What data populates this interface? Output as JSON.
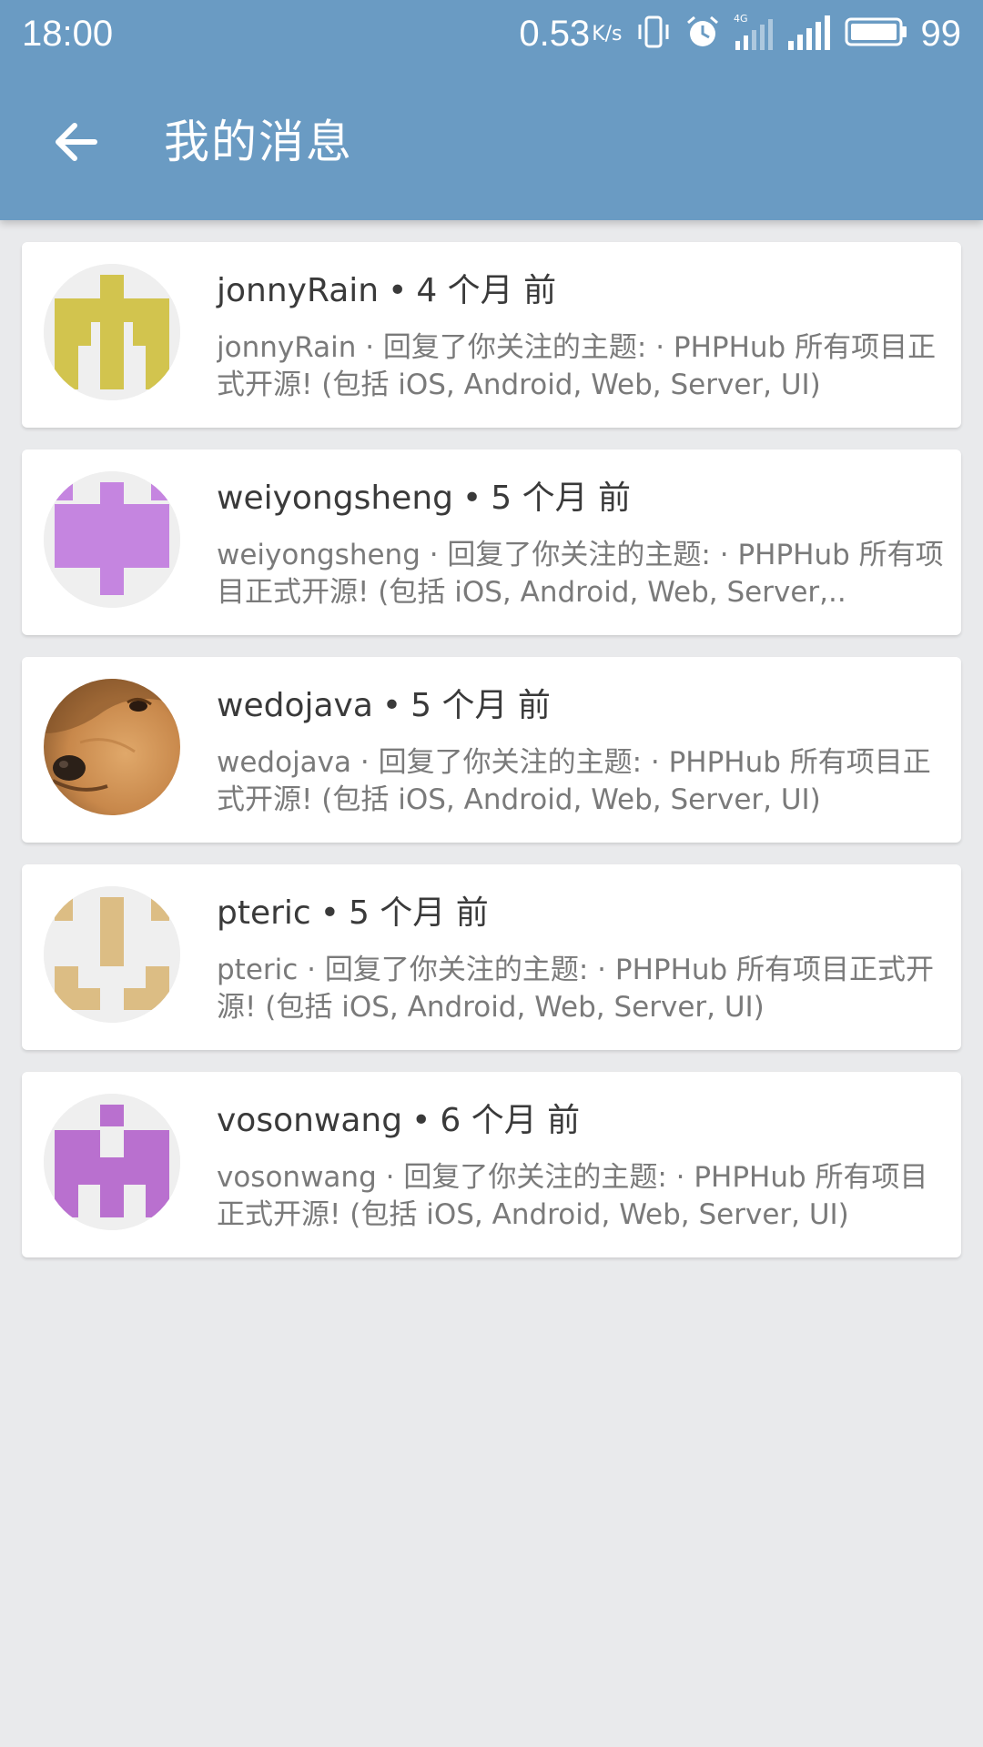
{
  "status_bar": {
    "time": "18:00",
    "speed": "0.53",
    "speed_unit": "K/s",
    "battery": "99",
    "icons": [
      "vibrate-icon",
      "alarm-icon",
      "4g-signal-icon",
      "signal-icon",
      "battery-icon"
    ]
  },
  "toolbar": {
    "back_icon": "arrow-back-icon",
    "title": "我的消息"
  },
  "colors": {
    "appbar": "#6a9bc3",
    "background": "#e9eaec",
    "card": "#ffffff"
  },
  "messages": [
    {
      "user": "jonnyRain",
      "time": "4 个月 前",
      "text": "jonnyRain · 回复了你关注的主题: · PHPHub 所有项目正式开源! (包括 iOS, Android, Web, Server, UI)",
      "avatar": "identicon-yellow"
    },
    {
      "user": "weiyongsheng",
      "time": "5 个月 前",
      "text": "weiyongsheng · 回复了你关注的主题: · PHPHub 所有项目正式开源! (包括 iOS, Android, Web, Server,..",
      "avatar": "identicon-violet"
    },
    {
      "user": "wedojava",
      "time": "5 个月 前",
      "text": "wedojava · 回复了你关注的主题: · PHPHub 所有项目正式开源! (包括 iOS, Android, Web, Server, UI)",
      "avatar": "dog-photo"
    },
    {
      "user": "pteric",
      "time": "5 个月 前",
      "text": "pteric · 回复了你关注的主题: · PHPHub 所有项目正式开源! (包括 iOS, Android, Web, Server, UI)",
      "avatar": "identicon-tan"
    },
    {
      "user": "vosonwang",
      "time": "6 个月 前",
      "text": "vosonwang · 回复了你关注的主题: · PHPHub 所有项目正式开源! (包括 iOS, Android, Web, Server, UI)",
      "avatar": "identicon-purple"
    }
  ]
}
